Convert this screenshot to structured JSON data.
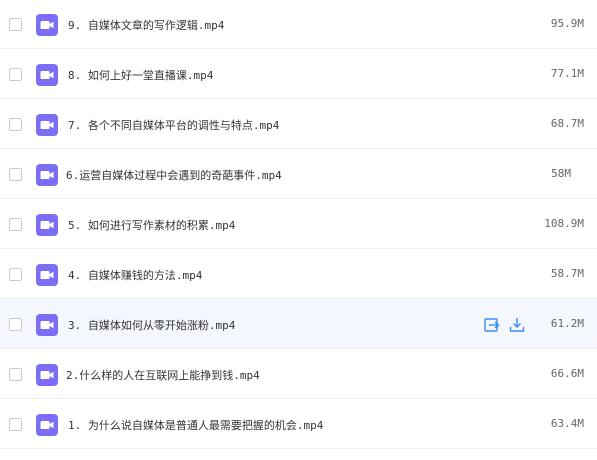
{
  "files": [
    {
      "name": "9. 自媒体文章的写作逻辑.mp4",
      "size": "95.9M",
      "icon": "video-file-icon"
    },
    {
      "name": "8. 如何上好一堂直播课.mp4",
      "size": "77.1M",
      "icon": "video-file-icon"
    },
    {
      "name": "7. 各个不同自媒体平台的调性与特点.mp4",
      "size": "68.7M",
      "icon": "video-file-icon"
    },
    {
      "name": "6.运营自媒体过程中会遇到的奇葩事件.mp4",
      "size": "58M",
      "icon": "video-file-icon"
    },
    {
      "name": "5. 如何进行写作素材的积累.mp4",
      "size": "108.9M",
      "icon": "video-file-icon"
    },
    {
      "name": "4. 自媒体赚钱的方法.mp4",
      "size": "58.7M",
      "icon": "video-file-icon"
    },
    {
      "name": "3. 自媒体如何从零开始涨粉.mp4",
      "size": "61.2M",
      "icon": "video-file-icon",
      "hover": true,
      "actions": [
        "share-icon",
        "download-icon"
      ]
    },
    {
      "name": "2.什么样的人在互联网上能挣到钱.mp4",
      "size": "66.6M",
      "icon": "video-file-icon"
    },
    {
      "name": "1. 为什么说自媒体是普通人最需要把握的机会.mp4",
      "size": "63.4M",
      "icon": "video-file-icon"
    }
  ],
  "colors": {
    "icon_bg": "#7b6ef5",
    "action_blue": "#3b8cf0",
    "hover_row": "#f4f7fd"
  }
}
